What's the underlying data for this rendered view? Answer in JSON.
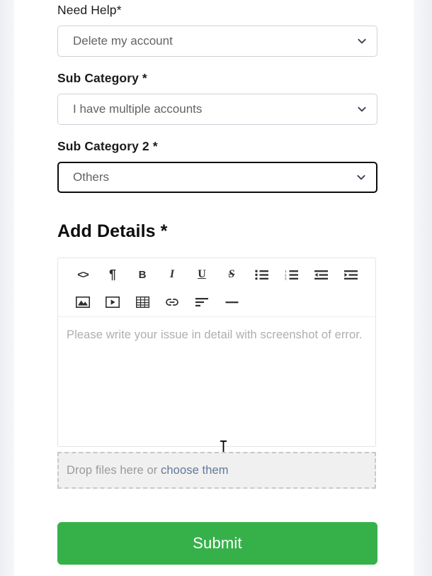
{
  "form": {
    "fields": [
      {
        "label": "Need Help*",
        "label_weight": "regular",
        "value": "Delete my account",
        "focused": false
      },
      {
        "label": "Sub Category *",
        "label_weight": "bold",
        "value": "I have multiple accounts",
        "focused": false
      },
      {
        "label": "Sub Category 2 *",
        "label_weight": "bold",
        "value": "Others",
        "focused": true
      }
    ],
    "details_heading": "Add Details *"
  },
  "editor": {
    "placeholder": "Please write your issue in detail with screenshot of error.",
    "toolbar_row_1": [
      {
        "name": "code-icon",
        "glyph": "<>",
        "title": "Code"
      },
      {
        "name": "paragraph-icon",
        "glyph": "¶",
        "title": "Paragraph"
      },
      {
        "name": "bold-icon",
        "glyph": "B",
        "title": "Bold"
      },
      {
        "name": "italic-icon",
        "glyph": "I",
        "title": "Italic"
      },
      {
        "name": "underline-icon",
        "glyph": "U",
        "title": "Underline"
      },
      {
        "name": "strikethrough-icon",
        "glyph": "S",
        "title": "Strikethrough"
      },
      {
        "name": "unordered-list-icon",
        "glyph": "",
        "title": "Bulleted list"
      },
      {
        "name": "ordered-list-icon",
        "glyph": "",
        "title": "Numbered list"
      },
      {
        "name": "outdent-icon",
        "glyph": "",
        "title": "Decrease indent"
      },
      {
        "name": "indent-icon",
        "glyph": "",
        "title": "Increase indent"
      }
    ],
    "toolbar_row_2": [
      {
        "name": "image-icon",
        "title": "Insert image"
      },
      {
        "name": "video-icon",
        "title": "Insert video"
      },
      {
        "name": "table-icon",
        "title": "Insert table"
      },
      {
        "name": "link-icon",
        "title": "Insert link"
      },
      {
        "name": "align-icon",
        "title": "Align"
      },
      {
        "name": "horizontal-rule-icon",
        "title": "Horizontal rule"
      }
    ]
  },
  "dropzone": {
    "text": "Drop files here or ",
    "link": "choose them"
  },
  "submit": {
    "label": "Submit"
  },
  "colors": {
    "submit_green": "#36b14a",
    "link_blue": "#61789b",
    "page_bg": "#f1f3f6",
    "card_bg": "#ffffff",
    "focus_border": "#0c0c0c",
    "placeholder_gray": "#aeaeae"
  }
}
